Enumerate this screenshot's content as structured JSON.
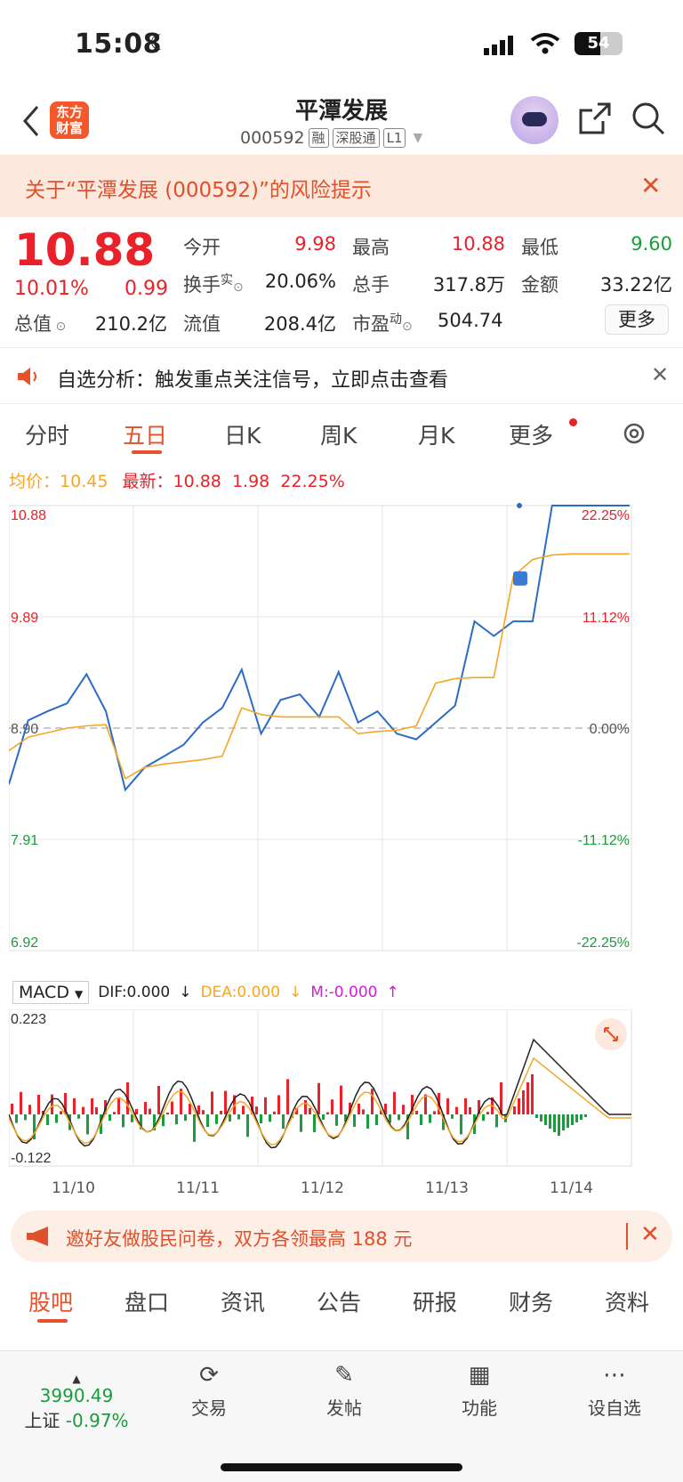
{
  "status": {
    "time": "15:08",
    "battery": "54"
  },
  "header": {
    "logo_line1": "东方",
    "logo_line2": "财富",
    "title": "平潭发展",
    "code": "000592",
    "tags": [
      "融",
      "深股通",
      "L1"
    ]
  },
  "risk": {
    "text": "关于“平潭发展 (000592)”的风险提示"
  },
  "quote": {
    "price": "10.88",
    "pct": "10.01%",
    "change": "0.99",
    "labels": {
      "open": "今开",
      "high": "最高",
      "low": "最低",
      "turnover": "换手",
      "turnover_sup": "实",
      "volume": "总手",
      "amount": "金额",
      "mktcap": "总值",
      "float": "流值",
      "pe": "市盈",
      "pe_sup": "动"
    },
    "values": {
      "open": "9.98",
      "high": "10.88",
      "low": "9.60",
      "turnover": "20.06%",
      "volume": "317.8万",
      "amount": "33.22亿",
      "mktcap": "210.2亿",
      "float": "208.4亿",
      "pe": "504.74"
    },
    "more": "更多"
  },
  "analysis": {
    "text": "自选分析：触发重点关注信号，立即点击查看"
  },
  "tabs": [
    "分时",
    "五日",
    "日K",
    "周K",
    "月K",
    "更多"
  ],
  "legend": {
    "avg_label": "均价：",
    "avg": "10.45",
    "latest_label": "最新：",
    "latest": "10.88",
    "chg": "1.98",
    "pct": "22.25%"
  },
  "chart_data": {
    "type": "line",
    "x": [
      "11/10",
      "11/11",
      "11/12",
      "11/13",
      "11/14"
    ],
    "left_ticks": [
      "10.88",
      "9.89",
      "8.90",
      "7.91",
      "6.92"
    ],
    "right_ticks": [
      "22.25%",
      "11.12%",
      "0.00%",
      "-11.12%",
      "-22.25%"
    ],
    "ylim": [
      6.92,
      10.88
    ],
    "prev_close": 8.9,
    "series": [
      {
        "name": "最新",
        "values": [
          8.4,
          8.97,
          9.05,
          9.12,
          9.38,
          9.05,
          8.35,
          8.55,
          8.65,
          8.75,
          8.95,
          9.08,
          9.42,
          8.85,
          9.15,
          9.2,
          9.0,
          9.4,
          8.95,
          9.05,
          8.85,
          8.8,
          8.95,
          9.1,
          9.85,
          9.72,
          9.85,
          9.85,
          10.88,
          10.88,
          10.88,
          10.88,
          10.88
        ]
      },
      {
        "name": "均价",
        "values": [
          8.7,
          8.82,
          8.86,
          8.9,
          8.92,
          8.93,
          8.45,
          8.55,
          8.58,
          8.6,
          8.62,
          8.65,
          9.08,
          9.02,
          9.0,
          9.0,
          9.0,
          9.0,
          8.85,
          8.87,
          8.88,
          8.92,
          9.3,
          9.34,
          9.35,
          9.35,
          10.25,
          10.4,
          10.44,
          10.45,
          10.45,
          10.45,
          10.45
        ]
      }
    ],
    "macd": {
      "indicator": "MACD",
      "dif": "DIF:0.000",
      "dea": "DEA:0.000",
      "m": "M:-0.000",
      "top": "0.223",
      "bottom": "-0.122"
    }
  },
  "invite": {
    "text": "邀好友做股民问卷，双方各领最高 188 元"
  },
  "bottom_tabs": [
    "股吧",
    "盘口",
    "资讯",
    "公告",
    "研报",
    "财务",
    "资料"
  ],
  "footer": {
    "index_value": "3990.49",
    "index_name": "上证",
    "index_change": "-0.97%",
    "items": [
      "交易",
      "发帖",
      "功能",
      "设自选"
    ]
  },
  "colors": {
    "up": "#e8212a",
    "down": "#1a9c3c",
    "accent": "#e8502a",
    "line": "#2b6cc4",
    "avg": "#f5a623"
  }
}
